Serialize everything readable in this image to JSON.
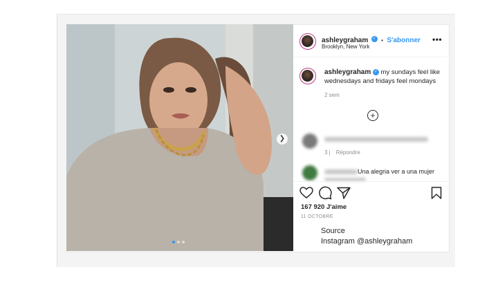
{
  "post": {
    "username": "ashleygraham",
    "verified_badge": "✓",
    "follow_label": "S'abonner",
    "separator_dot": "•",
    "location": "Brooklyn, New York",
    "more_label": "•••",
    "caption": "my sundays feel like wednesdays and fridays feel mondays",
    "caption_age": "2 sem",
    "load_more_icon": "plus-circle-icon",
    "comments": [
      {
        "time": "3 j",
        "reply_label": "Répondre"
      },
      {
        "text": "Una alegria ver a una mujer"
      }
    ],
    "likes": "167 920 J'aime",
    "date": "11 OCTOBRE",
    "carousel": {
      "slides": 3,
      "active": 0
    }
  },
  "credit": {
    "line1": "Source",
    "line2": "Instagram @ashleygraham"
  },
  "colors": {
    "accent": "#3897f0",
    "story_ring": "#c13584",
    "text": "#262626",
    "muted": "#8e8e8e"
  }
}
